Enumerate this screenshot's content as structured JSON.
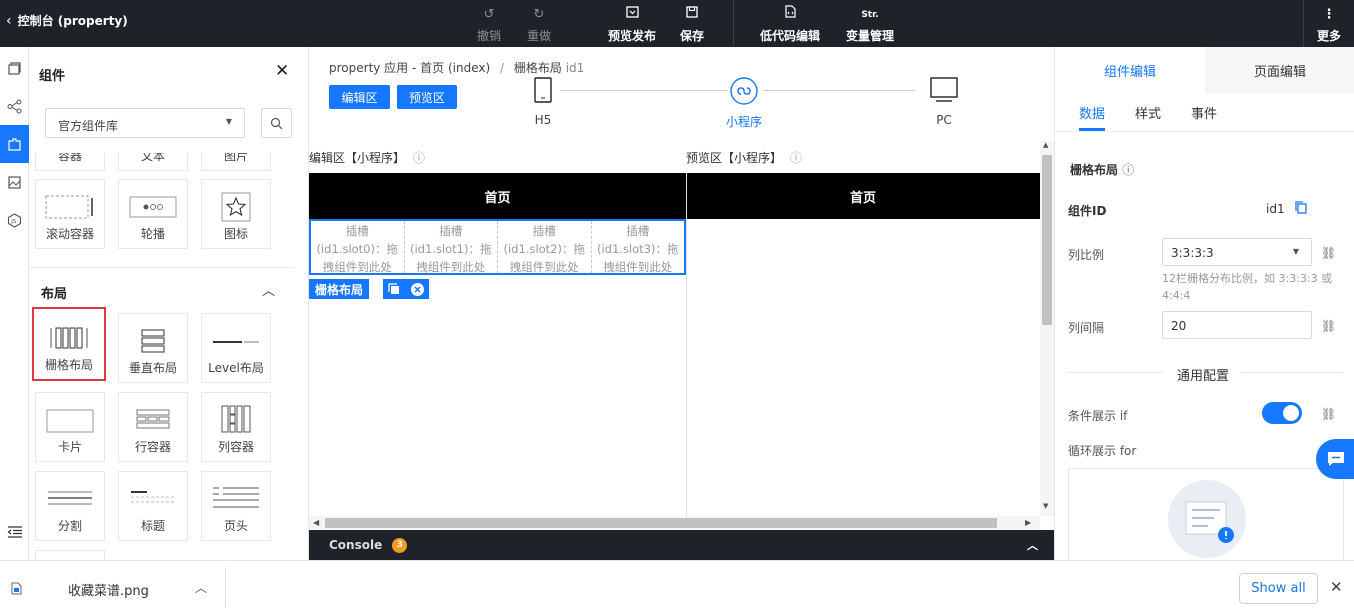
{
  "topbar": {
    "back_label": "控制台 (property)",
    "undo": "撤销",
    "redo": "重做",
    "preview_publish": "预览发布",
    "save": "保存",
    "lowcode": "低代码编辑",
    "variables_icon_text": "Str.",
    "variables": "变量管理",
    "more": "更多"
  },
  "left_panel": {
    "title": "组件",
    "library_select": "官方组件库",
    "partial_row": [
      "容器",
      "文本",
      "图片"
    ],
    "row1": [
      "滚动容器",
      "轮播",
      "图标"
    ],
    "section": "布局",
    "layout": [
      "栅格布局",
      "垂直布局",
      "Level布局",
      "卡片",
      "行容器",
      "列容器",
      "分割",
      "标题",
      "页头"
    ]
  },
  "center": {
    "breadcrumb_app": "property 应用 - 首页 (index)",
    "breadcrumb_sep": "/",
    "breadcrumb_comp": "栅格布局",
    "breadcrumb_id": "id1",
    "edit_btn": "编辑区",
    "preview_btn": "预览区",
    "devices": [
      "H5",
      "小程序",
      "PC"
    ],
    "edit_header": "编辑区【小程序】",
    "preview_header": "预览区【小程序】",
    "page_title": "首页",
    "slots": [
      [
        "插槽",
        "(id1.slot0)：拖",
        "拽组件到此处"
      ],
      [
        "插槽",
        "(id1.slot1)：拖",
        "拽组件到此处"
      ],
      [
        "插槽",
        "(id1.slot2)：拖",
        "拽组件到此处"
      ],
      [
        "插槽",
        "(id1.slot3)：拖",
        "拽组件到此处"
      ]
    ],
    "grid_tag": "栅格布局",
    "console_label": "Console",
    "console_count": "3"
  },
  "right_panel": {
    "tab_component": "组件编辑",
    "tab_page": "页面编辑",
    "sub_data": "数据",
    "sub_style": "样式",
    "sub_event": "事件",
    "section_title": "栅格布局",
    "id_label": "组件ID",
    "id_value": "id1",
    "ratio_label": "列比例",
    "ratio_value": "3:3:3:3",
    "ratio_hint": "12栏栅格分布比例，如 3:3:3:3 或 4:4:4",
    "gap_label": "列间隔",
    "gap_value": "20",
    "general_config": "通用配置",
    "cond_label": "条件展示 if",
    "cond_on": true,
    "loop_label": "循环展示 for"
  },
  "download_bar": {
    "file_name": "收藏菜谱.png",
    "show_all": "Show all"
  },
  "colors": {
    "accent": "#1677ff",
    "topbar_bg": "#1f2329",
    "highlight": "#e03b3b",
    "badge": "#f59a23"
  }
}
